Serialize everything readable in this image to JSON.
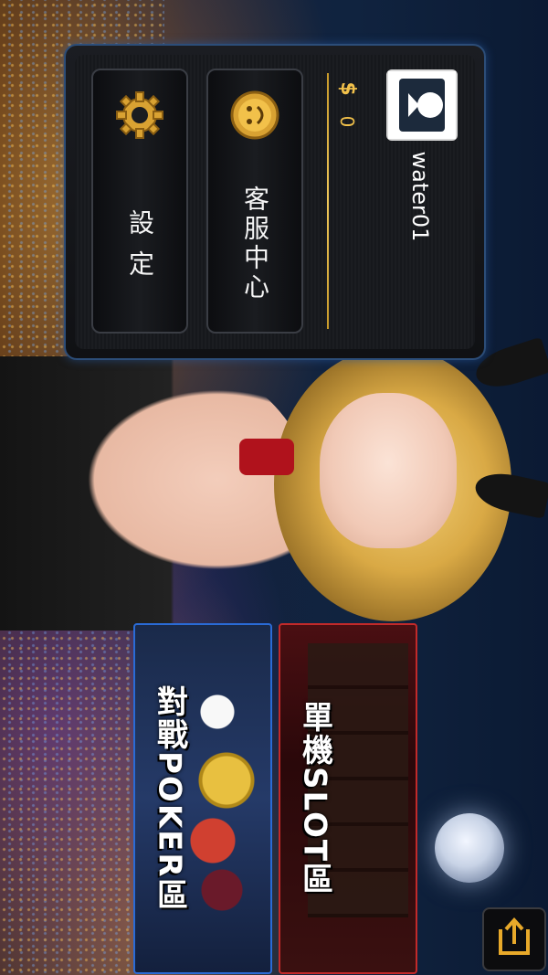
{
  "profile": {
    "username": "water01",
    "currency_symbol": "$",
    "coins": "0"
  },
  "menu": {
    "customer_service": "客服中心",
    "settings": "設 定"
  },
  "games": {
    "poker": "對戰POKER區",
    "slot": "單機SLOT區"
  },
  "icons": {
    "avatar": "user-avatar-icon",
    "coin": "smiley-coin-icon",
    "settings": "gear-icon",
    "share": "share-icon"
  },
  "colors": {
    "gold": "#f2c14a",
    "panel_border": "#2c4d78",
    "poker_border": "#2a6bd6",
    "slot_border": "#c22a2a"
  }
}
